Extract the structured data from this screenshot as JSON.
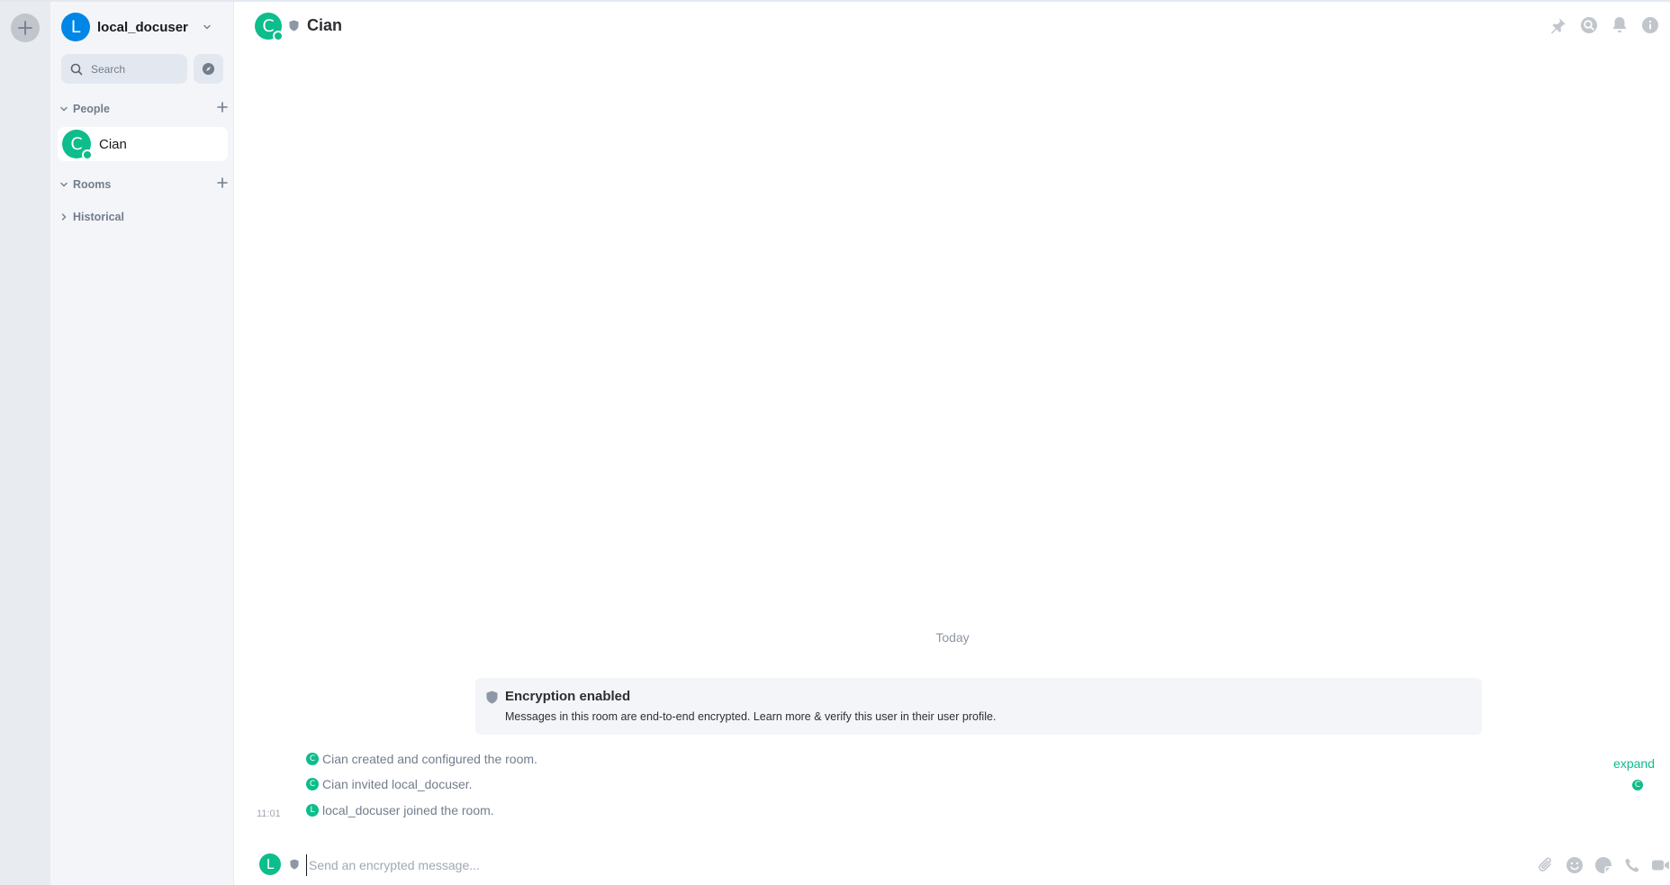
{
  "spaces": {
    "add_icon": "plus-icon"
  },
  "user_menu": {
    "avatar_letter": "L",
    "name": "local_docuser",
    "avatar_color": "#0086e6"
  },
  "search": {
    "placeholder": "Search"
  },
  "sections": {
    "people": {
      "label": "People"
    },
    "rooms": {
      "label": "Rooms"
    },
    "historical": {
      "label": "Historical"
    }
  },
  "people": [
    {
      "name": "Cian",
      "avatar_letter": "C",
      "avatar_color": "#0dbd8b",
      "online": true
    }
  ],
  "header": {
    "room_name": "Cian",
    "avatar_letter": "C",
    "icons": [
      "pin-icon",
      "search-icon",
      "bell-icon",
      "info-icon"
    ]
  },
  "timeline": {
    "date_separator": "Today",
    "encryption": {
      "title": "Encryption enabled",
      "description": "Messages in this room are end-to-end encrypted. Learn more & verify this user in their user profile."
    },
    "events": [
      {
        "avatar_letter": "C",
        "text": "Cian created and configured the room."
      },
      {
        "avatar_letter": "C",
        "text": "Cian invited local_docuser."
      },
      {
        "avatar_letter": "L",
        "text": "local_docuser joined the room.",
        "timestamp": "11:01"
      }
    ],
    "expand_label": "expand",
    "read_receipt_letter": "C"
  },
  "composer": {
    "avatar_letter": "L",
    "placeholder": "Send an encrypted message...",
    "icons": [
      "attachment-icon",
      "emoji-icon",
      "sticker-icon",
      "voice-call-icon",
      "video-call-icon"
    ]
  },
  "colors": {
    "accent": "#0dbd8b",
    "sidebar_bg": "#f3f5f8",
    "space_bg": "#e8ebef"
  }
}
